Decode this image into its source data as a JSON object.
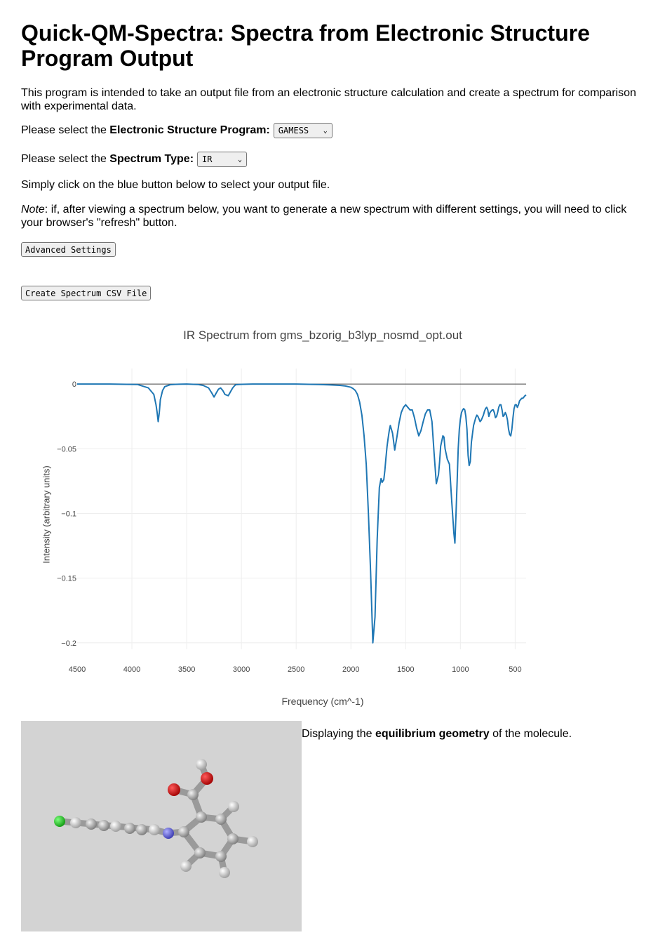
{
  "page": {
    "title": "Quick-QM-Spectra: Spectra from Electronic Structure Program Output",
    "intro": "This program is intended to take an output file from an electronic structure calculation and create a spectrum for comparison with experimental data.",
    "program_prefix": "Please select the ",
    "program_bold": "Electronic Structure Program:",
    "program_value": "GAMESS",
    "spectrum_prefix": "Please select the ",
    "spectrum_bold": "Spectrum Type:",
    "spectrum_value": "IR",
    "click_instruction": "Simply click on the blue button below to select your output file.",
    "note_label": "Note",
    "note_text": ": if, after viewing a spectrum below, you want to generate a new spectrum with different settings, you will need to click your browser's \"refresh\" button.",
    "advanced_button": "Advanced Settings",
    "csv_button": "Create Spectrum CSV File"
  },
  "geometry": {
    "prefix": "Displaying the ",
    "bold": "equilibrium geometry",
    "suffix": " of the molecule."
  },
  "colors": {
    "line": "#1f77b4",
    "grid": "#eeeeee",
    "zero_line": "#444444",
    "viewer_bg": "#d3d3d3"
  },
  "chart_data": {
    "type": "line",
    "title": "IR Spectrum from gms_bzorig_b3lyp_nosmd_opt.out",
    "xlabel": "Frequency (cm^-1)",
    "ylabel": "Intensity (arbitrary units)",
    "xlim": [
      4500,
      400
    ],
    "ylim": [
      -0.205,
      0.012
    ],
    "x_reversed": true,
    "xticks": [
      4500,
      4000,
      3500,
      3000,
      2500,
      2000,
      1500,
      1000,
      500
    ],
    "xtick_labels": [
      "4500",
      "4000",
      "3500",
      "3000",
      "2500",
      "2000",
      "1500",
      "1000",
      "500"
    ],
    "yticks": [
      0,
      -0.05,
      -0.1,
      -0.15,
      -0.2
    ],
    "ytick_labels": [
      "0",
      "−0.05",
      "−0.1",
      "−0.15",
      "−0.2"
    ],
    "grid": true,
    "series": [
      {
        "x": [
          4500,
          4200,
          3950,
          3850,
          3800,
          3780,
          3770,
          3760,
          3750,
          3740,
          3720,
          3700,
          3650,
          3600,
          3500,
          3400,
          3350,
          3300,
          3270,
          3250,
          3230,
          3210,
          3190,
          3170,
          3150,
          3120,
          3100,
          3080,
          3060,
          3050,
          3000,
          2900,
          2700,
          2500,
          2300,
          2200,
          2100,
          2050,
          2000,
          1980,
          1960,
          1940,
          1920,
          1900,
          1880,
          1860,
          1840,
          1820,
          1800,
          1780,
          1760,
          1740,
          1725,
          1720,
          1715,
          1700,
          1690,
          1680,
          1670,
          1660,
          1650,
          1640,
          1620,
          1600,
          1580,
          1560,
          1540,
          1520,
          1500,
          1480,
          1460,
          1440,
          1420,
          1400,
          1380,
          1360,
          1340,
          1320,
          1300,
          1280,
          1260,
          1240,
          1220,
          1200,
          1190,
          1180,
          1170,
          1160,
          1150,
          1140,
          1120,
          1100,
          1080,
          1060,
          1050,
          1040,
          1030,
          1020,
          1010,
          1000,
          990,
          980,
          970,
          960,
          950,
          940,
          930,
          920,
          910,
          900,
          880,
          860,
          850,
          840,
          830,
          820,
          810,
          800,
          790,
          780,
          770,
          760,
          750,
          740,
          730,
          720,
          710,
          700,
          690,
          680,
          670,
          660,
          650,
          640,
          630,
          620,
          610,
          600,
          590,
          580,
          570,
          560,
          550,
          540,
          530,
          520,
          510,
          500,
          490,
          480,
          470,
          460,
          450,
          440,
          430,
          420,
          410,
          400
        ],
        "y": [
          0,
          0,
          -0.0003,
          -0.003,
          -0.008,
          -0.016,
          -0.022,
          -0.029,
          -0.022,
          -0.012,
          -0.005,
          -0.002,
          -0.0005,
          -0.0002,
          0,
          -0.0003,
          -0.001,
          -0.003,
          -0.007,
          -0.01,
          -0.007,
          -0.004,
          -0.003,
          -0.005,
          -0.008,
          -0.009,
          -0.006,
          -0.003,
          -0.001,
          -0.0005,
          -0.0002,
          0,
          0,
          0,
          -0.0003,
          -0.0006,
          -0.001,
          -0.0015,
          -0.0025,
          -0.0035,
          -0.005,
          -0.008,
          -0.014,
          -0.024,
          -0.04,
          -0.062,
          -0.1,
          -0.145,
          -0.2,
          -0.18,
          -0.12,
          -0.08,
          -0.073,
          -0.074,
          -0.076,
          -0.074,
          -0.067,
          -0.057,
          -0.048,
          -0.042,
          -0.036,
          -0.032,
          -0.038,
          -0.051,
          -0.041,
          -0.03,
          -0.022,
          -0.018,
          -0.016,
          -0.018,
          -0.02,
          -0.02,
          -0.026,
          -0.034,
          -0.04,
          -0.036,
          -0.029,
          -0.023,
          -0.02,
          -0.02,
          -0.029,
          -0.054,
          -0.077,
          -0.07,
          -0.06,
          -0.048,
          -0.044,
          -0.04,
          -0.041,
          -0.05,
          -0.058,
          -0.062,
          -0.09,
          -0.115,
          -0.123,
          -0.1,
          -0.075,
          -0.05,
          -0.035,
          -0.027,
          -0.022,
          -0.02,
          -0.019,
          -0.02,
          -0.025,
          -0.035,
          -0.055,
          -0.063,
          -0.06,
          -0.045,
          -0.032,
          -0.026,
          -0.024,
          -0.025,
          -0.027,
          -0.029,
          -0.028,
          -0.026,
          -0.024,
          -0.021,
          -0.019,
          -0.018,
          -0.02,
          -0.025,
          -0.022,
          -0.021,
          -0.02,
          -0.02,
          -0.022,
          -0.026,
          -0.025,
          -0.022,
          -0.018,
          -0.016,
          -0.016,
          -0.02,
          -0.025,
          -0.024,
          -0.022,
          -0.024,
          -0.028,
          -0.035,
          -0.039,
          -0.04,
          -0.035,
          -0.026,
          -0.019,
          -0.016,
          -0.016,
          -0.018,
          -0.016,
          -0.013,
          -0.012,
          -0.011,
          -0.011,
          -0.01,
          -0.009,
          -0.0085
        ]
      }
    ]
  }
}
